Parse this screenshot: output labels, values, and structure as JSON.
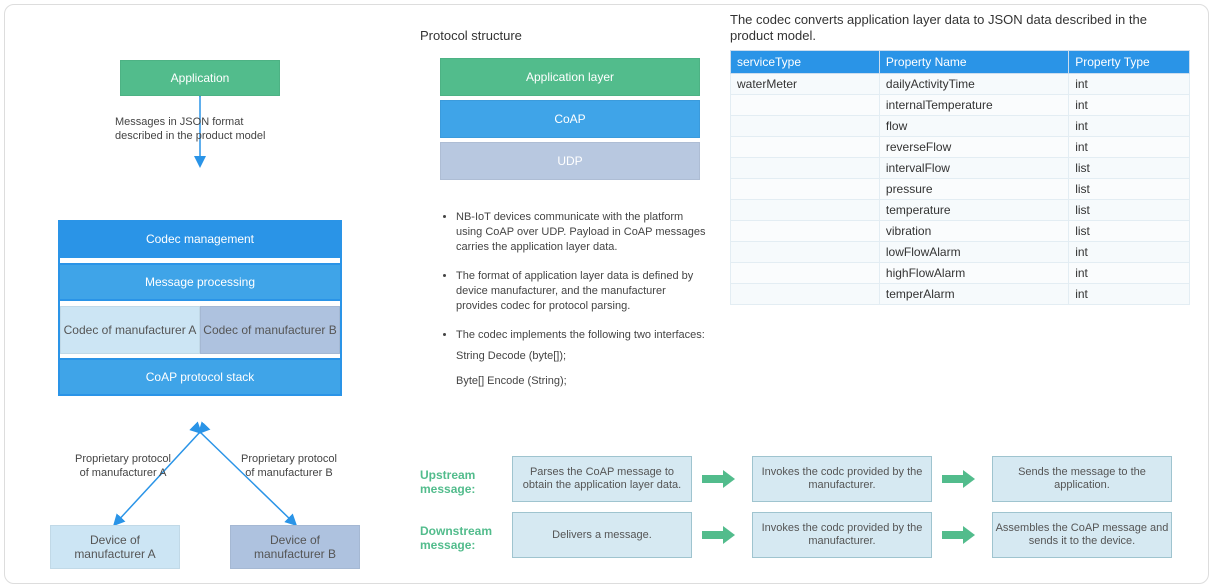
{
  "left_diagram": {
    "application": "Application",
    "json_msg_caption_1": "Messages in JSON format",
    "json_msg_caption_2": "described in the product model",
    "codec_mgmt": "Codec management",
    "msg_proc": "Message processing",
    "codec_a": "Codec of manufacturer A",
    "codec_b": "Codec of manufacturer B",
    "coap_stack": "CoAP protocol stack",
    "prop_a_1": "Proprietary protocol",
    "prop_a_2": "of manufacturer A",
    "prop_b_1": "Proprietary protocol",
    "prop_b_2": "of manufacturer B",
    "device_a": "Device of manufacturer A",
    "device_b": "Device of manufacturer B"
  },
  "protocol": {
    "heading": "Protocol structure",
    "app_layer": "Application layer",
    "coap": "CoAP",
    "udp": "UDP"
  },
  "bullets": {
    "b1": "NB-IoT devices communicate with the platform using CoAP over UDP. Payload in CoAP messages carries the application layer data.",
    "b2": "The format of application layer data is defined by device manufacturer, and the manufacturer provides codec for protocol parsing.",
    "b3": "The codec implements the following two interfaces:",
    "if1": "String Decode (byte[]);",
    "if2": "Byte[] Encode (String);"
  },
  "table_caption": "The codec converts application layer data to JSON data described in the product model.",
  "table": {
    "headers": {
      "c1": "serviceType",
      "c2": "Property Name",
      "c3": "Property Type"
    },
    "rows": [
      {
        "c1": "waterMeter",
        "c2": "dailyActivityTime",
        "c3": "int"
      },
      {
        "c1": "",
        "c2": "internalTemperature",
        "c3": "int"
      },
      {
        "c1": "",
        "c2": "flow",
        "c3": "int"
      },
      {
        "c1": "",
        "c2": "reverseFlow",
        "c3": "int"
      },
      {
        "c1": "",
        "c2": "intervalFlow",
        "c3": "list"
      },
      {
        "c1": "",
        "c2": "pressure",
        "c3": "list"
      },
      {
        "c1": "",
        "c2": "temperature",
        "c3": "list"
      },
      {
        "c1": "",
        "c2": "vibration",
        "c3": "list"
      },
      {
        "c1": "",
        "c2": "lowFlowAlarm",
        "c3": "int"
      },
      {
        "c1": "",
        "c2": "highFlowAlarm",
        "c3": "int"
      },
      {
        "c1": "",
        "c2": "temperAlarm",
        "c3": "int"
      }
    ]
  },
  "flow": {
    "up_label": "Upstream message:",
    "up": [
      "Parses the CoAP message to obtain the application layer data.",
      "Invokes the codc provided by the manufacturer.",
      "Sends the message to the application."
    ],
    "down_label": "Downstream message:",
    "down": [
      "Delivers a message.",
      "Invokes the codc provided by the manufacturer.",
      "Assembles the CoAP message and sends it to the device."
    ]
  }
}
